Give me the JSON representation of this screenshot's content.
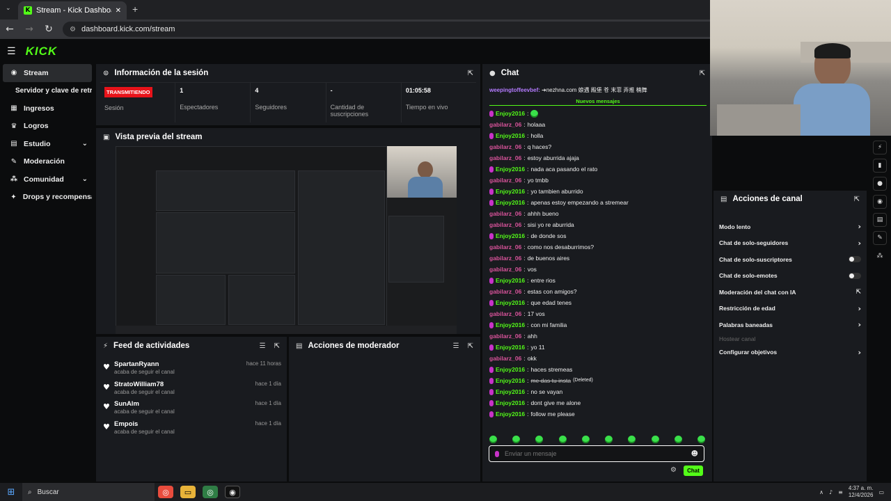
{
  "browser": {
    "tab_title": "Stream - Kick Dashboard",
    "url": "dashboard.kick.com/stream"
  },
  "header": {
    "logo": "KICK"
  },
  "sidebar": {
    "items": [
      {
        "label": "Stream",
        "icon": "broadcast-icon",
        "active": true
      },
      {
        "label": "Servidor y clave de retransmisión",
        "sub": true
      },
      {
        "label": "Ingresos",
        "icon": "money-icon"
      },
      {
        "label": "Logros",
        "icon": "trophy-icon"
      },
      {
        "label": "Estudio",
        "icon": "studio-icon",
        "expandable": true
      },
      {
        "label": "Moderación",
        "icon": "wrench-icon"
      },
      {
        "label": "Comunidad",
        "icon": "community-icon",
        "expandable": true
      },
      {
        "label": "Drops y recompensas",
        "icon": "gift-icon"
      }
    ]
  },
  "session": {
    "title": "Información de la sesión",
    "status_badge": "TRANSMITIENDO",
    "status_label": "Sesión",
    "viewers_value": "1",
    "viewers_label": "Espectadores",
    "followers_value": "4",
    "followers_label": "Seguidores",
    "subs_value": "-",
    "subs_label": "Cantidad de suscripciones",
    "live_value": "01:05:58",
    "live_label": "Tiempo en vivo"
  },
  "preview": {
    "title": "Vista previa del stream"
  },
  "feed": {
    "title": "Feed de actividades",
    "items": [
      {
        "name": "SpartanRyann",
        "desc": "acaba de seguir el canal",
        "time": "hace 11 horas"
      },
      {
        "name": "StratoWilliam78",
        "desc": "acaba de seguir el canal",
        "time": "hace 1 día"
      },
      {
        "name": "SunAlm",
        "desc": "acaba de seguir el canal",
        "time": "hace 1 día"
      },
      {
        "name": "Empois",
        "desc": "acaba de seguir el canal",
        "time": "hace 1 día"
      }
    ]
  },
  "mod_actions": {
    "title": "Acciones de moderador"
  },
  "chat": {
    "title": "Chat",
    "pinned": {
      "user": "weepingtoffeevbef:",
      "text": "➔nezhna.com 娘遇 殿堡 苍 末菲 弄推 楠舞"
    },
    "new_messages_label": "Nuevos mensajes",
    "messages": [
      {
        "user": "Enjoy2016",
        "text": "",
        "type": "u1",
        "emote": true
      },
      {
        "user": "gabilarz_06",
        "text": "holaaa",
        "type": "u2"
      },
      {
        "user": "Enjoy2016",
        "text": "holla",
        "type": "u1"
      },
      {
        "user": "gabilarz_06",
        "text": "q haces?",
        "type": "u2"
      },
      {
        "user": "gabilarz_06",
        "text": "estoy aburrida ajaja",
        "type": "u2"
      },
      {
        "user": "Enjoy2016",
        "text": "nada aca pasando el rato",
        "type": "u1"
      },
      {
        "user": "gabilarz_06",
        "text": "yo tmbb",
        "type": "u2"
      },
      {
        "user": "Enjoy2016",
        "text": "yo tambien aburrido",
        "type": "u1"
      },
      {
        "user": "Enjoy2016",
        "text": "apenas estoy empezando a stremear",
        "type": "u1"
      },
      {
        "user": "gabilarz_06",
        "text": "ahhh bueno",
        "type": "u2"
      },
      {
        "user": "gabilarz_06",
        "text": "sisi yo re aburrida",
        "type": "u2"
      },
      {
        "user": "Enjoy2016",
        "text": "de donde sos",
        "type": "u1"
      },
      {
        "user": "gabilarz_06",
        "text": "como nos desaburrimos?",
        "type": "u2"
      },
      {
        "user": "gabilarz_06",
        "text": "de buenos aires",
        "type": "u2"
      },
      {
        "user": "gabilarz_06",
        "text": "vos",
        "type": "u2"
      },
      {
        "user": "Enjoy2016",
        "text": "entre rios",
        "type": "u1"
      },
      {
        "user": "gabilarz_06",
        "text": "estas con amigos?",
        "type": "u2"
      },
      {
        "user": "Enjoy2016",
        "text": "que edad tenes",
        "type": "u1"
      },
      {
        "user": "gabilarz_06",
        "text": "17 vos",
        "type": "u2"
      },
      {
        "user": "Enjoy2016",
        "text": "con mi familia",
        "type": "u1"
      },
      {
        "user": "gabilarz_06",
        "text": "ahh",
        "type": "u2"
      },
      {
        "user": "Enjoy2016",
        "text": "yo 11",
        "type": "u1"
      },
      {
        "user": "gabilarz_06",
        "text": "okk",
        "type": "u2"
      },
      {
        "user": "Enjoy2016",
        "text": "haces stremeas",
        "type": "u1"
      },
      {
        "user": "Enjoy2016",
        "text": "me das tu insta",
        "type": "u1",
        "deleted": true,
        "deleted_label": "(Deleted)"
      },
      {
        "user": "Enjoy2016",
        "text": "no se vayan",
        "type": "u1"
      },
      {
        "user": "Enjoy2016",
        "text": "dont give me alone",
        "type": "u1"
      },
      {
        "user": "Enjoy2016",
        "text": "follow me please",
        "type": "u1"
      }
    ],
    "input_placeholder": "Enviar un mensaje",
    "send_label": "Chat"
  },
  "channel_actions": {
    "title": "Acciones de canal",
    "items": [
      {
        "label": "Modo lento",
        "kind": "arrow"
      },
      {
        "label": "Chat de solo-seguidores",
        "kind": "arrow"
      },
      {
        "label": "Chat de solo-suscriptores",
        "kind": "toggle"
      },
      {
        "label": "Chat de solo-emotes",
        "kind": "toggle"
      },
      {
        "label": "Moderación del chat con IA",
        "kind": "external"
      },
      {
        "label": "Restricción de edad",
        "kind": "arrow"
      },
      {
        "label": "Palabras baneadas",
        "kind": "arrow"
      },
      {
        "label": "Hostear canal",
        "kind": "dim"
      },
      {
        "label": "Configurar objetivos",
        "kind": "arrow"
      }
    ]
  },
  "taskbar": {
    "search_label": "Buscar",
    "time": "4:37 a. m.",
    "date": "12/4/2026"
  },
  "colors": {
    "accent": "#53fc18",
    "live": "#e8131a",
    "user_a": "#53fc18",
    "user_b": "#d9539b"
  }
}
